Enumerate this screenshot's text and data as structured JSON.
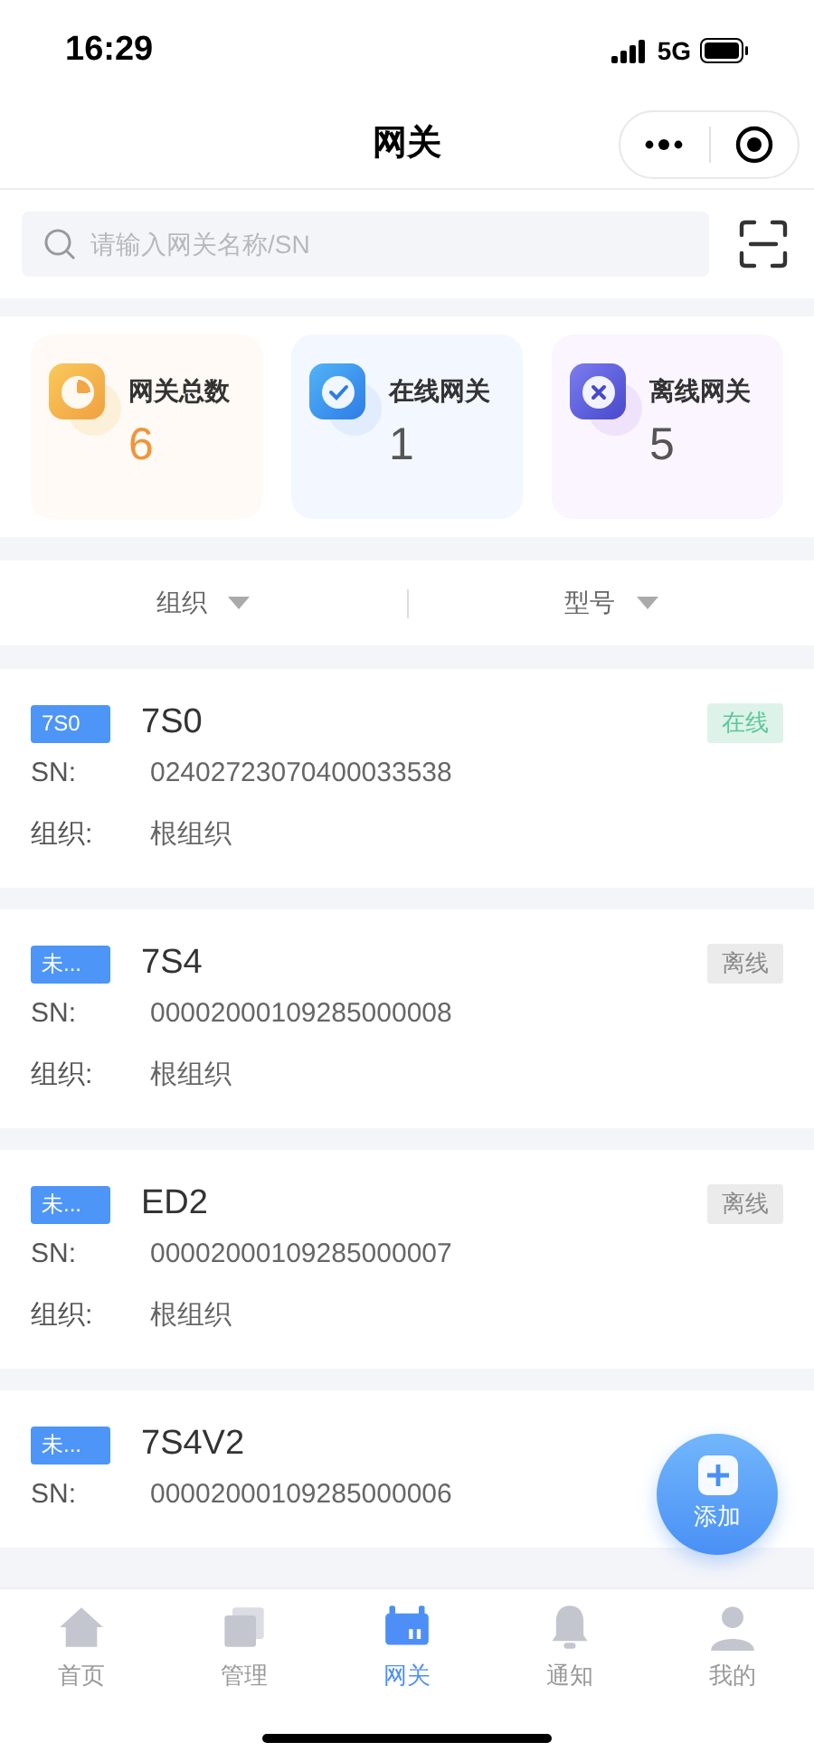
{
  "status_bar": {
    "time": "16:29",
    "network": "5G"
  },
  "nav": {
    "title": "网关"
  },
  "search": {
    "placeholder": "请输入网关名称/SN"
  },
  "stats": [
    {
      "kind": "total",
      "label": "网关总数",
      "value": "6"
    },
    {
      "kind": "online",
      "label": "在线网关",
      "value": "1"
    },
    {
      "kind": "offline",
      "label": "离线网关",
      "value": "5"
    }
  ],
  "filters": [
    {
      "label": "组织"
    },
    {
      "label": "型号"
    }
  ],
  "gateways": [
    {
      "tag": "7S0",
      "name": "7S0",
      "status": {
        "kind": "online",
        "label": "在线"
      },
      "rows": [
        {
          "label": "SN:",
          "value": "02402723070400033538"
        },
        {
          "label": "组织:",
          "value": "根组织"
        }
      ]
    },
    {
      "tag": "未...",
      "name": "7S4",
      "status": {
        "kind": "offline",
        "label": "离线"
      },
      "rows": [
        {
          "label": "SN:",
          "value": "00002000109285000008"
        },
        {
          "label": "组织:",
          "value": "根组织"
        }
      ]
    },
    {
      "tag": "未...",
      "name": "ED2",
      "status": {
        "kind": "offline",
        "label": "离线"
      },
      "rows": [
        {
          "label": "SN:",
          "value": "00002000109285000007"
        },
        {
          "label": "组织:",
          "value": "根组织"
        }
      ]
    },
    {
      "tag": "未...",
      "name": "7S4V2",
      "rows": [
        {
          "label": "SN:",
          "value": "00002000109285000006"
        }
      ]
    }
  ],
  "fab": {
    "label": "添加"
  },
  "tabs": [
    {
      "kind": "home",
      "label": "首页",
      "selected": false
    },
    {
      "kind": "manage",
      "label": "管理",
      "selected": false
    },
    {
      "kind": "gateway",
      "label": "网关",
      "selected": true
    },
    {
      "kind": "notify",
      "label": "通知",
      "selected": false
    },
    {
      "kind": "me",
      "label": "我的",
      "selected": false
    }
  ]
}
